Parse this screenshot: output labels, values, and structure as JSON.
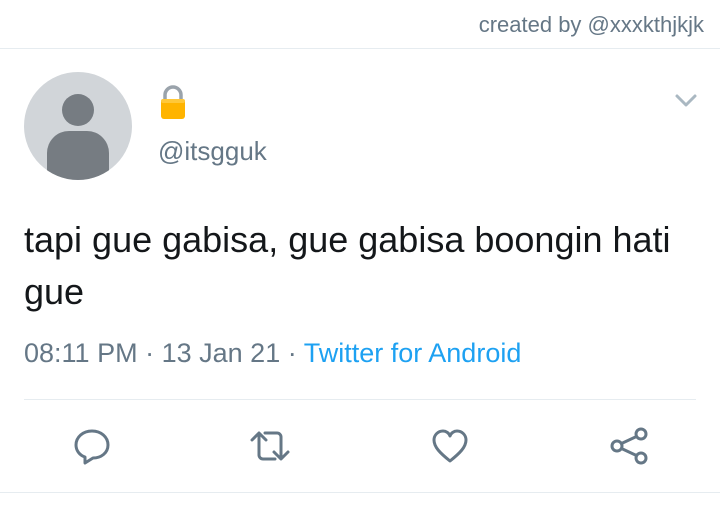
{
  "header": {
    "credit": "created by @xxxkthjkjk"
  },
  "tweet": {
    "avatar_icon": "default-avatar-icon",
    "protected_icon": "lock-icon",
    "handle": "@itsgguk",
    "text": "tapi gue gabisa, gue gabisa boongin hati gue",
    "time": "08:11 PM",
    "separator": "·",
    "date": "13 Jan 21",
    "source": "Twitter for Android"
  },
  "actions": {
    "reply_icon": "reply-icon",
    "retweet_icon": "retweet-icon",
    "like_icon": "heart-icon",
    "share_icon": "share-icon",
    "menu_icon": "chevron-down-icon"
  },
  "colors": {
    "secondary_text": "#657786",
    "link": "#1da1f2",
    "divider": "#e6ecf0",
    "lock_gold": "#ffb400"
  }
}
